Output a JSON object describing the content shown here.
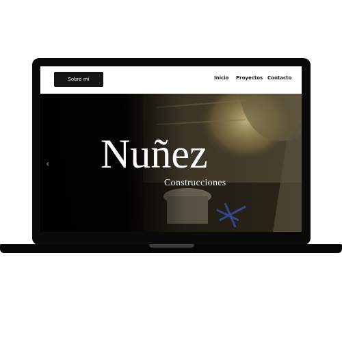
{
  "nav": {
    "about_label": "Sobre mí",
    "links": [
      "Inicio",
      "Proyectos",
      "Contacto"
    ]
  },
  "hero": {
    "brand": "Nuñez",
    "subtitle": "Construcciones",
    "prev_icon": "chevron-left-icon"
  },
  "colors": {
    "navbar_bg": "#ffffff",
    "button_bg": "#151515",
    "hero_text": "#ffffff",
    "laptop_frame": "#0a0a0a"
  }
}
